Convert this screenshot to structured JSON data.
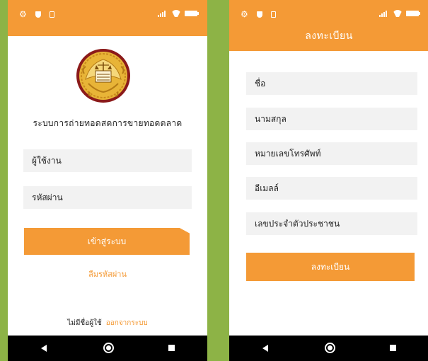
{
  "login_screen": {
    "system_title": "ระบบการถ่ายทอดสดการขายทอดตลาด",
    "username_placeholder": "ผู้ใช้งาน",
    "password_placeholder": "รหัสผ่าน",
    "login_button": "เข้าสู่ระบบ",
    "forgot_password": "ลืมรหัสผ่าน",
    "no_user_text": "ไม่มีชื่อผู้ใช้",
    "logout_link": "ออกจากระบบ"
  },
  "register_screen": {
    "title": "ลงทะเบียน",
    "fields": {
      "first_name": "ชื่อ",
      "last_name": "นามสกุล",
      "phone": "หมายเลขโทรศัพท์",
      "email": "อีเมลล์",
      "id_card": "เลขประจำตัวประชาชน"
    },
    "register_button": "ลงทะเบียน"
  },
  "colors": {
    "accent": "#f49a36",
    "background": "#8db346",
    "field_bg": "#f2f2f2",
    "nav_bar": "#000000"
  },
  "icons": {
    "status_left": [
      "gear-icon",
      "shield-icon",
      "sim-icon"
    ],
    "status_right": [
      "signal-icon",
      "wifi-icon",
      "battery-icon"
    ],
    "nav": [
      "back-icon",
      "home-icon",
      "recents-icon"
    ]
  }
}
